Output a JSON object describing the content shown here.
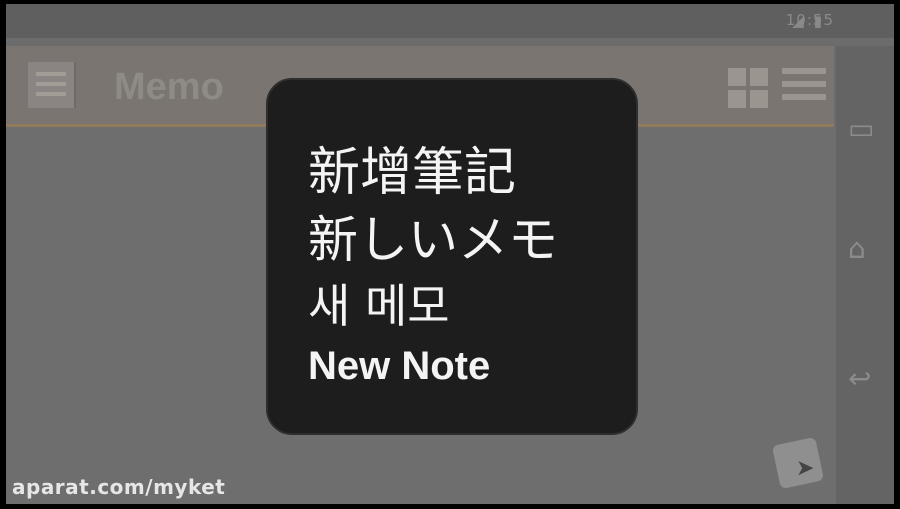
{
  "app": {
    "title": "Memo",
    "status_time": "10:55"
  },
  "overlay": {
    "lines": [
      "新增筆記",
      "新しいメモ",
      "새 메모",
      "New Note"
    ]
  },
  "watermark": "aparat.com/myket",
  "icons": {
    "app_icon": "memo-icon",
    "view_toggle": "grid-icon",
    "menu": "menu-icon",
    "nav_recent": "recent-apps-icon",
    "nav_home": "home-icon",
    "nav_back": "back-icon",
    "add_note": "add-note-icon"
  }
}
